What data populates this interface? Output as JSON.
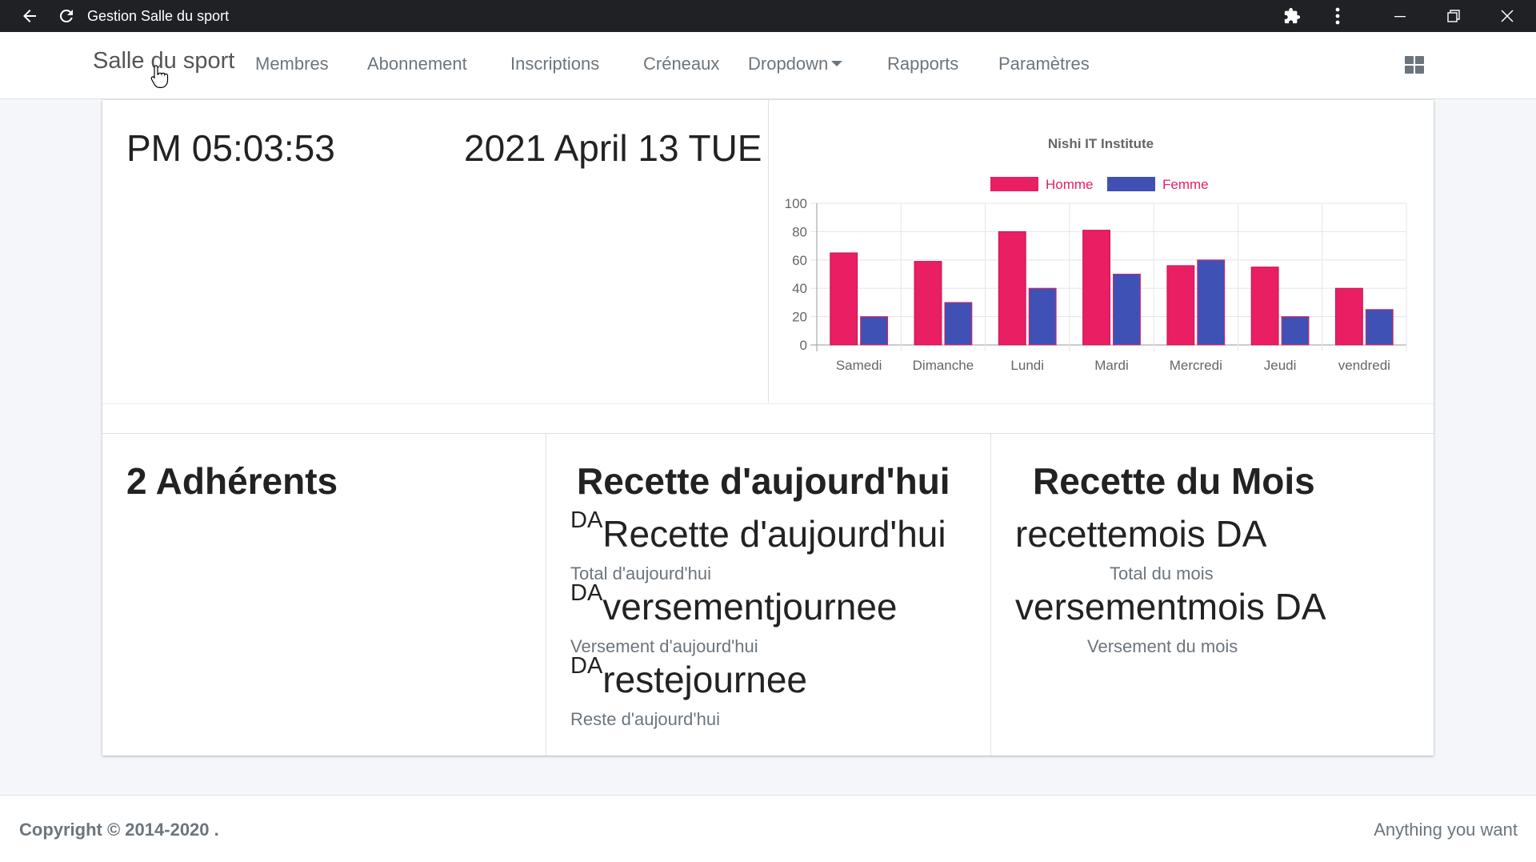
{
  "window": {
    "title": "Gestion Salle du sport",
    "icons": [
      "back-arrow-icon",
      "refresh-icon",
      "extensions-icon",
      "more-vert-icon",
      "minimize-icon",
      "restore-icon",
      "close-icon"
    ]
  },
  "navbar": {
    "brand": "Salle du sport",
    "items": [
      {
        "label": "Membres"
      },
      {
        "label": "Abonnement"
      },
      {
        "label": "Inscriptions"
      },
      {
        "label": "Créneaux"
      },
      {
        "label": "Dropdown"
      },
      {
        "label": "Rapports"
      },
      {
        "label": "Paramètres"
      }
    ]
  },
  "clock": {
    "time": "PM 05:03:53",
    "date": "2021 April 13 TUE"
  },
  "chart_data": {
    "type": "bar",
    "title": "Nishi IT Institute",
    "categories": [
      "Samedi",
      "Dimanche",
      "Lundi",
      "Mardi",
      "Mercredi",
      "Jeudi",
      "vendredi"
    ],
    "series": [
      {
        "name": "Homme",
        "values": [
          65,
          59,
          80,
          81,
          56,
          55,
          40
        ],
        "color": "#e91e63"
      },
      {
        "name": "Femme",
        "values": [
          20,
          30,
          40,
          50,
          60,
          20,
          25
        ],
        "color": "#3f51b5"
      }
    ],
    "ylim": [
      0,
      100
    ],
    "yticks": [
      "0",
      "20",
      "40",
      "60",
      "80",
      "100"
    ],
    "legend_position": "top",
    "legend_text_color": "#e91e63",
    "grid": true
  },
  "stats": {
    "adherents": "2 Adhérents",
    "today": {
      "title": "Recette d'aujourd'hui",
      "currency": "DA",
      "recette_value": "Recette d'aujourd'hui",
      "recette_label": "Total d'aujourd'hui",
      "versement_value": "versementjournee",
      "versement_label": "Versement d'aujourd'hui",
      "reste_value": "restejournee",
      "reste_label": "Reste d'aujourd'hui"
    },
    "month": {
      "title": "Recette du Mois",
      "recette_value": "recettemois DA",
      "recette_label": "Total du mois",
      "versement_value": "versementmois DA",
      "versement_label": "Versement du mois"
    }
  },
  "footer": {
    "copyright": "Copyright © 2014-2020 .",
    "right_text": "Anything you want"
  }
}
